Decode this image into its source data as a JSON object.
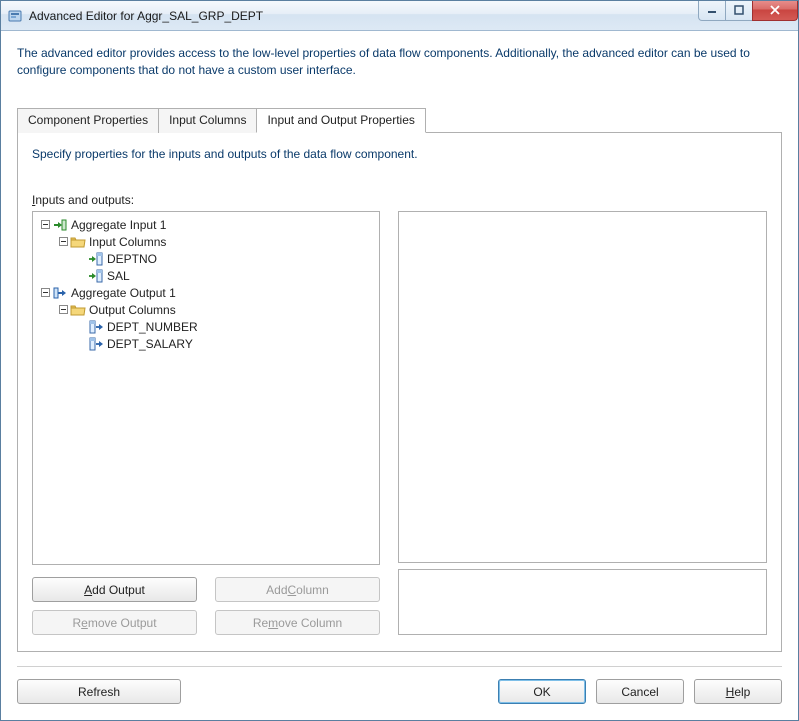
{
  "window": {
    "title": "Advanced Editor for Aggr_SAL_GRP_DEPT"
  },
  "description": "The advanced editor provides access to the low-level properties of data flow components. Additionally, the advanced editor can be used to configure components that do not have a custom user interface.",
  "tabs": [
    {
      "label": "Component Properties",
      "active": false
    },
    {
      "label": "Input Columns",
      "active": false
    },
    {
      "label": "Input and Output Properties",
      "active": true
    }
  ],
  "panel": {
    "instruction": "Specify properties for the inputs and outputs of the data flow component.",
    "subgroup_label_pre": "I",
    "subgroup_label_post": "nputs and outputs:"
  },
  "tree": {
    "input_root": "Aggregate Input 1",
    "input_folder": "Input Columns",
    "input_cols": [
      "DEPTNO",
      "SAL"
    ],
    "output_root": "Aggregate Output 1",
    "output_folder": "Output Columns",
    "output_cols": [
      "DEPT_NUMBER",
      "DEPT_SALARY"
    ]
  },
  "buttons": {
    "add_output_pre": "A",
    "add_output_post": "dd Output",
    "add_column_pre": "Add ",
    "add_column_ul": "C",
    "add_column_post": "olumn",
    "remove_output_pre": "R",
    "remove_output_ul": "e",
    "remove_output_post": "move Output",
    "remove_column_pre": "Re",
    "remove_column_ul": "m",
    "remove_column_post": "ove Column"
  },
  "footer": {
    "refresh": "Refresh",
    "ok": "OK",
    "cancel": "Cancel",
    "help_ul": "H",
    "help_post": "elp"
  }
}
